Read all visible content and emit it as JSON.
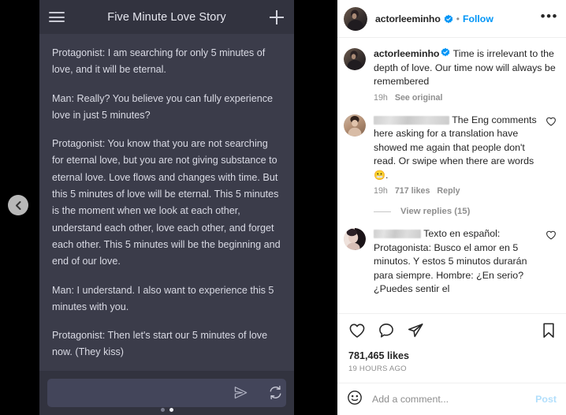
{
  "left_panel": {
    "carousel_prev_icon": "chevron-left-icon",
    "header": {
      "menu_icon": "hamburger-menu-icon",
      "title": "Five Minute Love Story",
      "add_icon": "plus-icon"
    },
    "script_paragraphs": [
      "Protagonist: I am searching for only 5 minutes of love, and it will be eternal.",
      "Man: Really? You believe you can fully experience love in just 5 minutes?",
      "Protagonist: You know that you are not searching for eternal love, but you are not giving substance to eternal love. Love flows and changes with time. But this 5 minutes of love will be eternal. This 5 minutes is the moment when we look at each other, understand each other, love each other, and forget each other. This 5 minutes will be the beginning and end of our love.",
      "Man: I understand. I also want to experience this 5 minutes with you.",
      "Protagonist: Then let's start our 5 minutes of love now. (They kiss)"
    ],
    "footer": {
      "input_value": "",
      "input_placeholder": "",
      "send_icon": "send-paper-plane-icon",
      "refresh_icon": "refresh-sync-icon",
      "pagination_dots": 2,
      "pagination_active_index": 1
    }
  },
  "instagram": {
    "header": {
      "avatar_icon": "user-avatar",
      "username": "actorleeminho",
      "verified_icon": "verified-badge-icon",
      "separator": "•",
      "follow_label": "Follow",
      "more_icon": "more-options-icon",
      "more_glyph": "•••"
    },
    "caption": {
      "avatar_icon": "user-avatar",
      "username": "actorleeminho",
      "verified_icon": "verified-badge-icon",
      "text": "Time is irrelevant to the depth of love. Our time now will always be remembered",
      "time": "19h",
      "see_original_label": "See original"
    },
    "comments": [
      {
        "avatar_icon": "user-avatar",
        "username_redacted": true,
        "username_redact_width": 96,
        "text": "The Eng comments here asking for a translation have showed me again that people don't read. Or swipe when there are words",
        "trailing_emoji": "😬",
        "trailing_text": ".",
        "time": "19h",
        "likes": "717 likes",
        "reply_label": "Reply",
        "like_icon": "heart-outline-icon",
        "view_replies_label": "View replies (15)"
      },
      {
        "avatar_icon": "user-avatar",
        "username_redacted": true,
        "username_redact_width": 60,
        "text": "Texto en español: Protagonista: Busco el amor en 5 minutos. Y estos 5 minutos durarán para siempre.",
        "clipped_text": "Hombre: ¿En serio? ¿Puedes sentir el",
        "like_icon": "heart-outline-icon"
      }
    ],
    "actions": {
      "like_icon": "heart-outline-icon",
      "comment_icon": "comment-bubble-icon",
      "share_icon": "share-paper-plane-icon",
      "save_icon": "bookmark-outline-icon",
      "likes_count": "781,465 likes",
      "post_time": "19 HOURS AGO"
    },
    "add_comment": {
      "emoji_icon": "emoji-smiley-icon",
      "input_value": "",
      "placeholder": "Add a comment...",
      "post_label": "Post"
    },
    "colors": {
      "accent_blue": "#0095f6",
      "post_disabled": "#b2dffc",
      "text_primary": "#262626",
      "text_secondary": "#8e8e8e"
    }
  }
}
